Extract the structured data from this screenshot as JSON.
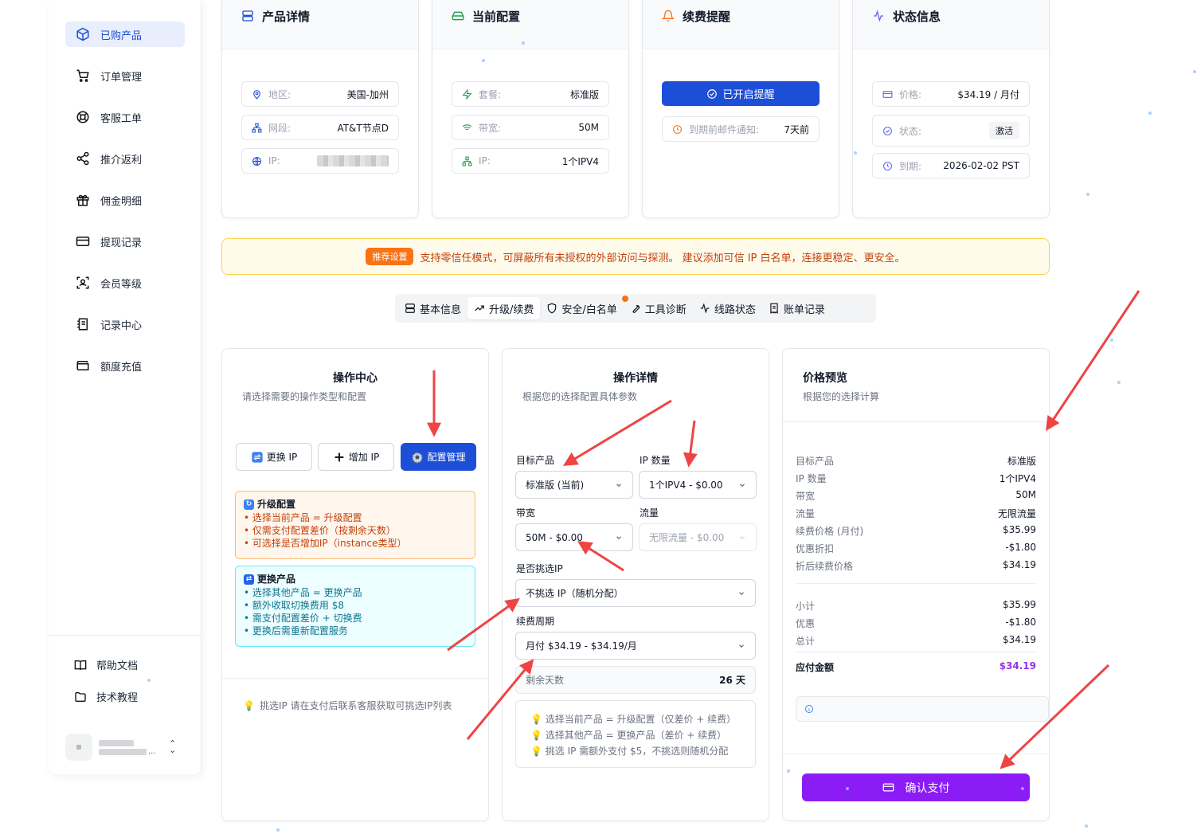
{
  "sidebar": {
    "items": [
      {
        "label": "已购产品",
        "icon": "box-icon",
        "active": true
      },
      {
        "label": "订单管理",
        "icon": "cart-icon"
      },
      {
        "label": "客服工单",
        "icon": "lifebuoy-icon"
      },
      {
        "label": "推介返利",
        "icon": "share-icon"
      },
      {
        "label": "佣金明细",
        "icon": "gift-icon"
      },
      {
        "label": "提现记录",
        "icon": "card-icon"
      },
      {
        "label": "会员等级",
        "icon": "scan-icon"
      },
      {
        "label": "记录中心",
        "icon": "notebook-icon"
      },
      {
        "label": "额度充值",
        "icon": "wallet-icon"
      }
    ],
    "help": [
      {
        "label": "帮助文档",
        "icon": "book-icon"
      },
      {
        "label": "技术教程",
        "icon": "folder-icon"
      }
    ],
    "user_name_suffix": "..."
  },
  "cards": {
    "product": {
      "title": "产品详情",
      "rows": [
        {
          "label": "地区:",
          "value": "美国-加州"
        },
        {
          "label": "网段:",
          "value": "AT&T节点D"
        },
        {
          "label": "IP:",
          "value": ""
        }
      ]
    },
    "config": {
      "title": "当前配置",
      "rows": [
        {
          "label": "套餐:",
          "value": "标准版"
        },
        {
          "label": "带宽:",
          "value": "50M"
        },
        {
          "label": "IP:",
          "value": "1个IPV4"
        }
      ]
    },
    "renew": {
      "title": "续费提醒",
      "button": "已开启提醒",
      "row": {
        "label": "到期前邮件通知:",
        "value": "7天前"
      }
    },
    "status": {
      "title": "状态信息",
      "rows": [
        {
          "label": "价格:",
          "value": "$34.19 / 月付"
        },
        {
          "label": "状态:",
          "value": "激活"
        },
        {
          "label": "到期:",
          "value": "2026-02-02 PST"
        }
      ]
    }
  },
  "banner": {
    "badge": "推荐设置",
    "text": "支持零信任模式，可屏蔽所有未授权的外部访问与探测。 建议添加可信 IP 白名单，连接更稳定、更安全。"
  },
  "tabs": [
    {
      "label": "基本信息",
      "icon": "server-icon"
    },
    {
      "label": "升级/续费",
      "icon": "trend-up-icon",
      "active": true
    },
    {
      "label": "安全/白名单",
      "icon": "shield-icon",
      "badge": true
    },
    {
      "label": "工具诊断",
      "icon": "wrench-icon"
    },
    {
      "label": "线路状态",
      "icon": "activity-icon"
    },
    {
      "label": "账单记录",
      "icon": "receipt-icon"
    }
  ],
  "ops": {
    "title": "操作中心",
    "subtitle": "请选择需要的操作类型和配置",
    "buttons": [
      {
        "label": "更换 IP",
        "icon": "swap-icon"
      },
      {
        "label": "增加 IP",
        "icon": "plus-icon"
      },
      {
        "label": "配置管理",
        "icon": "gear-icon",
        "active": true
      }
    ],
    "upgrade": {
      "title": "升级配置",
      "lines": [
        "• 选择当前产品 = 升级配置",
        "• 仅需支付配置差价（按剩余天数）",
        "• 可选择是否增加IP（instance类型）"
      ]
    },
    "change": {
      "title": "更换产品",
      "lines": [
        "• 选择其他产品 = 更换产品",
        "• 额外收取切换费用 $8",
        "• 需支付配置差价 + 切换费",
        "• 更换后需重新配置服务"
      ]
    },
    "hint": "挑选IP 请在支付后联系客服获取可挑选IP列表"
  },
  "detail": {
    "title": "操作详情",
    "subtitle": "根据您的选择配置具体参数",
    "target_label": "目标产品",
    "target_value": "标准版 (当前)",
    "ip_count_label": "IP 数量",
    "ip_count_value": "1个IPV4 - $0.00",
    "bandwidth_label": "带宽",
    "bandwidth_value": "50M - $0.00",
    "traffic_label": "流量",
    "traffic_value": "无限流量 - $0.00",
    "pick_ip_label": "是否挑选IP",
    "pick_ip_value": "不挑选 IP（随机分配）",
    "cycle_label": "续费周期",
    "cycle_value": "月付 $34.19 - $34.19/月",
    "days_label": "剩余天数",
    "days_value": "26 天",
    "tips": [
      "选择当前产品 = 升级配置（仅差价 + 续费）",
      "选择其他产品 = 更换产品（差价 + 续费）",
      "挑选 IP 需额外支付 $5，不挑选则随机分配"
    ]
  },
  "price": {
    "title": "价格预览",
    "subtitle": "根据您的选择计算",
    "rows": [
      {
        "k": "目标产品",
        "v": "标准版"
      },
      {
        "k": "IP 数量",
        "v": "1个IPV4"
      },
      {
        "k": "带宽",
        "v": "50M"
      },
      {
        "k": "流量",
        "v": "无限流量"
      },
      {
        "k": "续费价格 (月付)",
        "v": "$35.99"
      },
      {
        "k": "优惠折扣",
        "v": "-$1.80"
      },
      {
        "k": "折后续费价格",
        "v": "$34.19"
      }
    ],
    "totals": [
      {
        "k": "小计",
        "v": "$35.99"
      },
      {
        "k": "优惠",
        "v": "-$1.80"
      },
      {
        "k": "总计",
        "v": "$34.19"
      }
    ],
    "due_label": "应付金额",
    "due_value": "$34.19",
    "pay_button": "确认支付"
  },
  "colors": {
    "primary": "#1d4ed8",
    "pay": "#8b1cf6",
    "accent_red": "#ef4444",
    "banner_bg": "#fffbeb",
    "banner_text": "#c2410c"
  }
}
